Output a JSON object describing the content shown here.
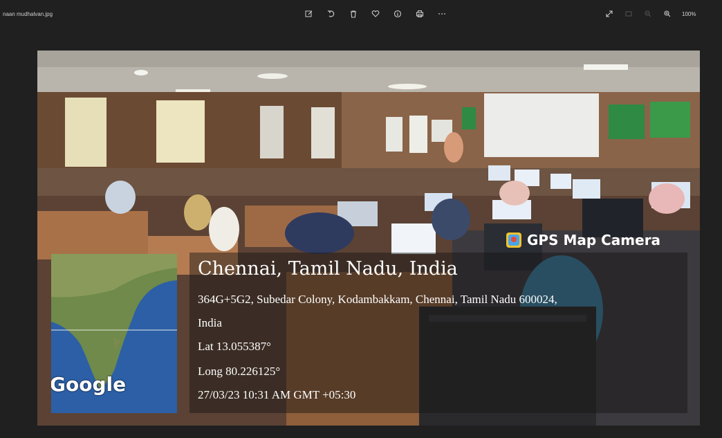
{
  "window": {
    "filename": "naan mudhalvan.jpg",
    "zoom": "100%"
  },
  "toolbar": {
    "center_icons": [
      "edit-icon",
      "rotate-icon",
      "delete-icon",
      "favorite-icon",
      "info-icon",
      "print-icon",
      "more-icon"
    ],
    "right_icons": [
      "expand-icon",
      "fit-icon",
      "zoom-out-icon",
      "zoom-in-icon"
    ]
  },
  "photo": {
    "watermark": "GPS Map Camera",
    "map_logo": "Google",
    "location_title": "Chennai, Tamil Nadu, India",
    "address_line1": "364G+5G2, Subedar Colony, Kodambakkam, Chennai, Tamil Nadu 600024,",
    "address_line2": "India",
    "lat": "Lat 13.055387°",
    "long": "Long 80.226125°",
    "timestamp": "27/03/23 10:31 AM GMT +05:30"
  },
  "colors": {
    "background": "#202020",
    "overlay": "#141414",
    "watermark_icon": "#f2c230"
  }
}
